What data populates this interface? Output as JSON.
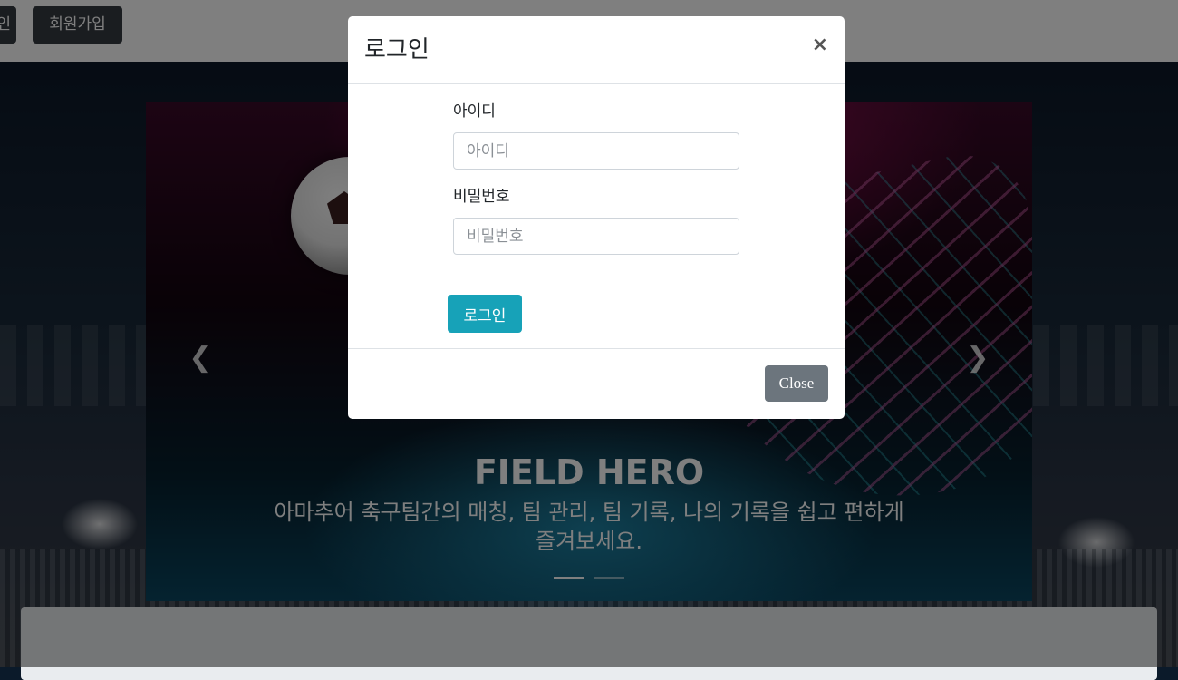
{
  "navbar": {
    "partial_button_label": "인",
    "signup_label": "회원가입"
  },
  "carousel": {
    "prev_icon": "chevron-left-icon",
    "next_icon": "chevron-right-icon",
    "title": "FIELD HERO",
    "text": "아마추어 축구팀간의 매칭, 팀 관리, 팀 기록, 나의 기록을 쉽고 편하게 즐겨보세요.",
    "slides": 2,
    "active_slide": 1
  },
  "modal": {
    "title": "로그인",
    "close_symbol": "×",
    "id_label": "아이디",
    "id_placeholder": "아이디",
    "password_label": "비밀번호",
    "password_placeholder": "비밀번호",
    "submit_label": "로그인",
    "close_label": "Close"
  },
  "colors": {
    "nav_button": "#343a40",
    "primary_info": "#17a2b8",
    "secondary": "#6c757d"
  }
}
